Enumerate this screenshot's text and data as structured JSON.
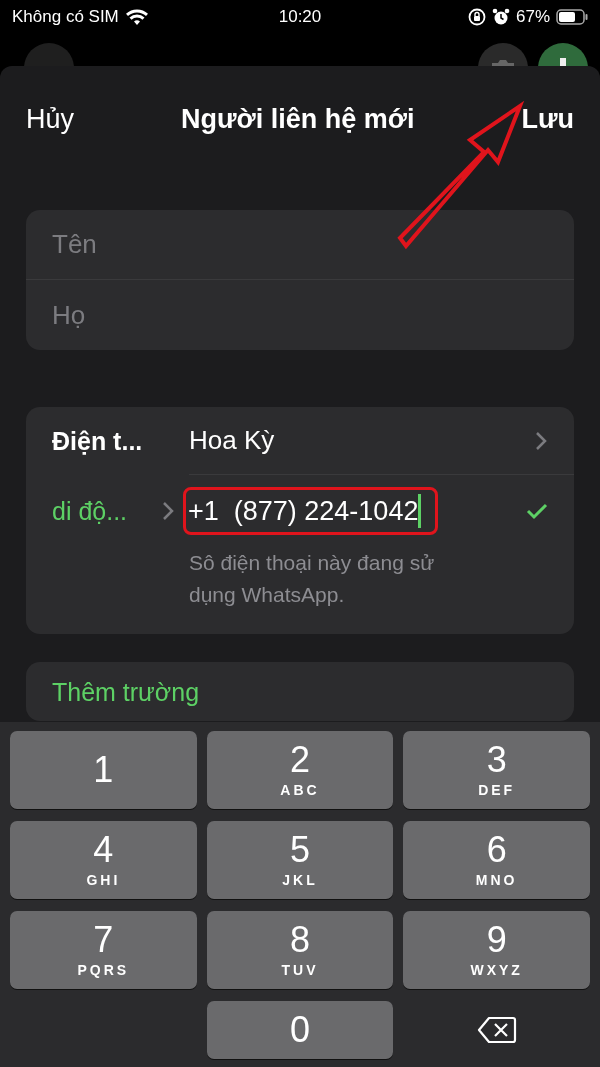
{
  "status_bar": {
    "carrier": "Không có SIM",
    "time": "10:20",
    "battery": "67%"
  },
  "nav": {
    "cancel": "Hủy",
    "title": "Người liên hệ mới",
    "save": "Lưu"
  },
  "name_fields": [
    {
      "placeholder": "Tên"
    },
    {
      "placeholder": "Họ"
    }
  ],
  "phone": {
    "label": "Điện t...",
    "country": "Hoa Kỳ",
    "type_label": "di độ...",
    "value": "+1  (877) 224-1042",
    "verified": true,
    "highlighted": true,
    "note": "Sô điện thoại này đang sử dụng WhatsApp."
  },
  "add_field": "Thêm trường",
  "keypad": [
    {
      "kind": "key",
      "digit": "1"
    },
    {
      "kind": "key",
      "digit": "2",
      "letters": "ABC"
    },
    {
      "kind": "key",
      "digit": "3",
      "letters": "DEF"
    },
    {
      "kind": "key",
      "digit": "4",
      "letters": "GHI"
    },
    {
      "kind": "key",
      "digit": "5",
      "letters": "JKL"
    },
    {
      "kind": "key",
      "digit": "6",
      "letters": "MNO"
    },
    {
      "kind": "key",
      "digit": "7",
      "letters": "PQRS"
    },
    {
      "kind": "key",
      "digit": "8",
      "letters": "TUV"
    },
    {
      "kind": "key",
      "digit": "9",
      "letters": "WXYZ"
    },
    {
      "kind": "blank"
    },
    {
      "kind": "key",
      "digit": "0"
    },
    {
      "kind": "delete"
    }
  ]
}
